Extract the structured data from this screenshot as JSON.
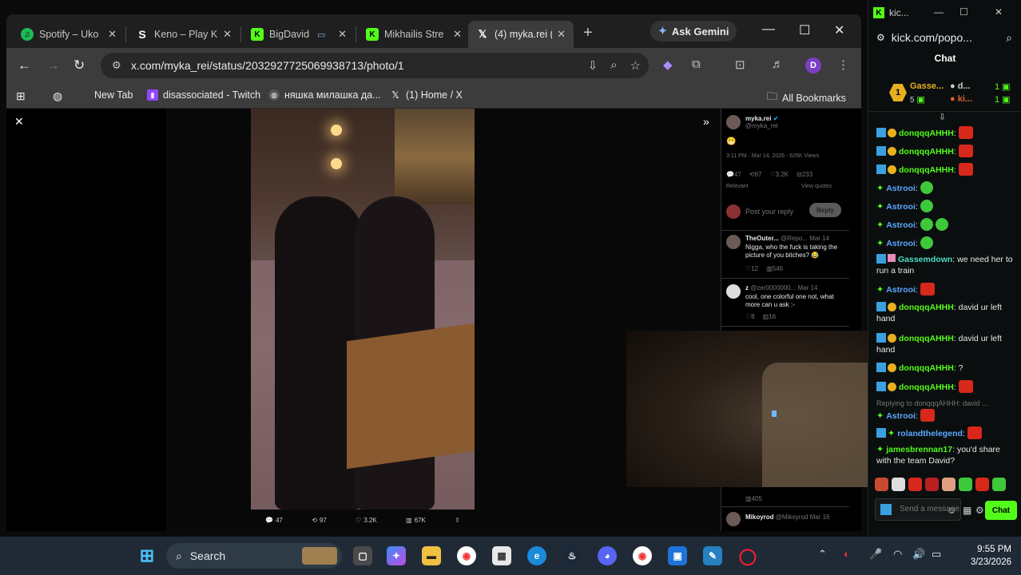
{
  "browser": {
    "tabs": [
      {
        "label": "Spotify – Uko",
        "icon": "spotify-icon",
        "color": "#1db954"
      },
      {
        "label": "Keno – Play K",
        "icon": "stake-icon",
        "color": "#1f1f1f"
      },
      {
        "label": "BigDavid",
        "icon": "kick-icon",
        "color": "#53fc18"
      },
      {
        "label": "Mikhailis Stre",
        "icon": "kick-icon",
        "color": "#53fc18"
      },
      {
        "label": "(4) myka.rei (",
        "icon": "x-icon",
        "color": "#000000"
      }
    ],
    "ask_gemini": "Ask Gemini",
    "url": "x.com/myka_rei/status/2032927725069938713/photo/1",
    "profile_initial": "D",
    "bookmarks": [
      "New Tab",
      "disassociated - Twitch",
      "няшка милашка да...",
      "(1) Home / X"
    ],
    "all_bookmarks": "All Bookmarks"
  },
  "tweet": {
    "author": "myka.rei",
    "handle": "@myka_rei",
    "emoji": "😁",
    "meta": "3:11 PM · Mar 14, 2026 · 626K Views",
    "stats": [
      "47",
      "97",
      "3.2K",
      "233"
    ],
    "reply_placeholder": "Post your reply",
    "reply_button": "Reply",
    "relevant": "Relevant",
    "view_quotes": "View quotes",
    "replies": [
      {
        "author": "TheOuter...",
        "handle": "@Repo...",
        "date": "Mar 14",
        "text": "Nigga, who the fuck is taking the picture of you bitches? 😂",
        "stats": [
          "12",
          "546"
        ]
      },
      {
        "author": "z",
        "handle": "@zer0000000...",
        "date": "Mar 14",
        "text": "cool, one colorful one not, what more can u ask :-",
        "stats": [
          "8",
          "16"
        ]
      },
      {
        "author": "Mikoyrod",
        "handle": "@Mikoyrod",
        "date": "Mar 16",
        "text": "",
        "stats": []
      }
    ],
    "photo_actions": [
      "47",
      "97",
      "3.2K",
      "67K"
    ],
    "late_stats": [
      "405"
    ]
  },
  "kick": {
    "title": "kic...",
    "url": "kick.com/popo...",
    "header": "Chat",
    "gifter_top": "Gasse...",
    "gifter_count": "5",
    "gifter_rank": "1",
    "gifter_a": "d...",
    "gifter_b": "ki...",
    "gifter_a_count": "1",
    "gifter_b_count": "1",
    "messages": [
      {
        "user": "donqqqAHHH",
        "text": ""
      },
      {
        "user": "donqqqAHHH",
        "text": ""
      },
      {
        "user": "donqqqAHHH",
        "text": ""
      },
      {
        "user": "Astrooi",
        "text": ""
      },
      {
        "user": "Astrooi",
        "text": ""
      },
      {
        "user": "Astrooi",
        "text": ""
      },
      {
        "user": "Astrooi",
        "text": ""
      },
      {
        "user": "Gassemdown",
        "text": "we need her to run a train"
      },
      {
        "user": "Astrooi",
        "text": ""
      },
      {
        "user": "donqqqAHHH",
        "text": "david ur left hand"
      },
      {
        "user": "donqqqAHHH",
        "text": "david ur left hand"
      },
      {
        "user": "donqqqAHHH",
        "text": "?"
      },
      {
        "user": "donqqqAHHH",
        "text": ""
      },
      {
        "user": "Astrooi",
        "text": ""
      },
      {
        "user": "rolandthelegend",
        "text": ""
      },
      {
        "user": "jamesbrennan17",
        "text": "you'd share with the team David?"
      }
    ],
    "reply_note": "Replying to donqqqAHHH: david ...",
    "input_placeholder": "Send a message",
    "chat_button": "Chat"
  },
  "taskbar": {
    "search": "Search",
    "time": "9:55 PM",
    "date": "3/23/2026"
  },
  "colors": {
    "kick_green": "#53fc18",
    "chrome_dark": "#1f1f1f",
    "taskbar": "#1f2a36"
  }
}
